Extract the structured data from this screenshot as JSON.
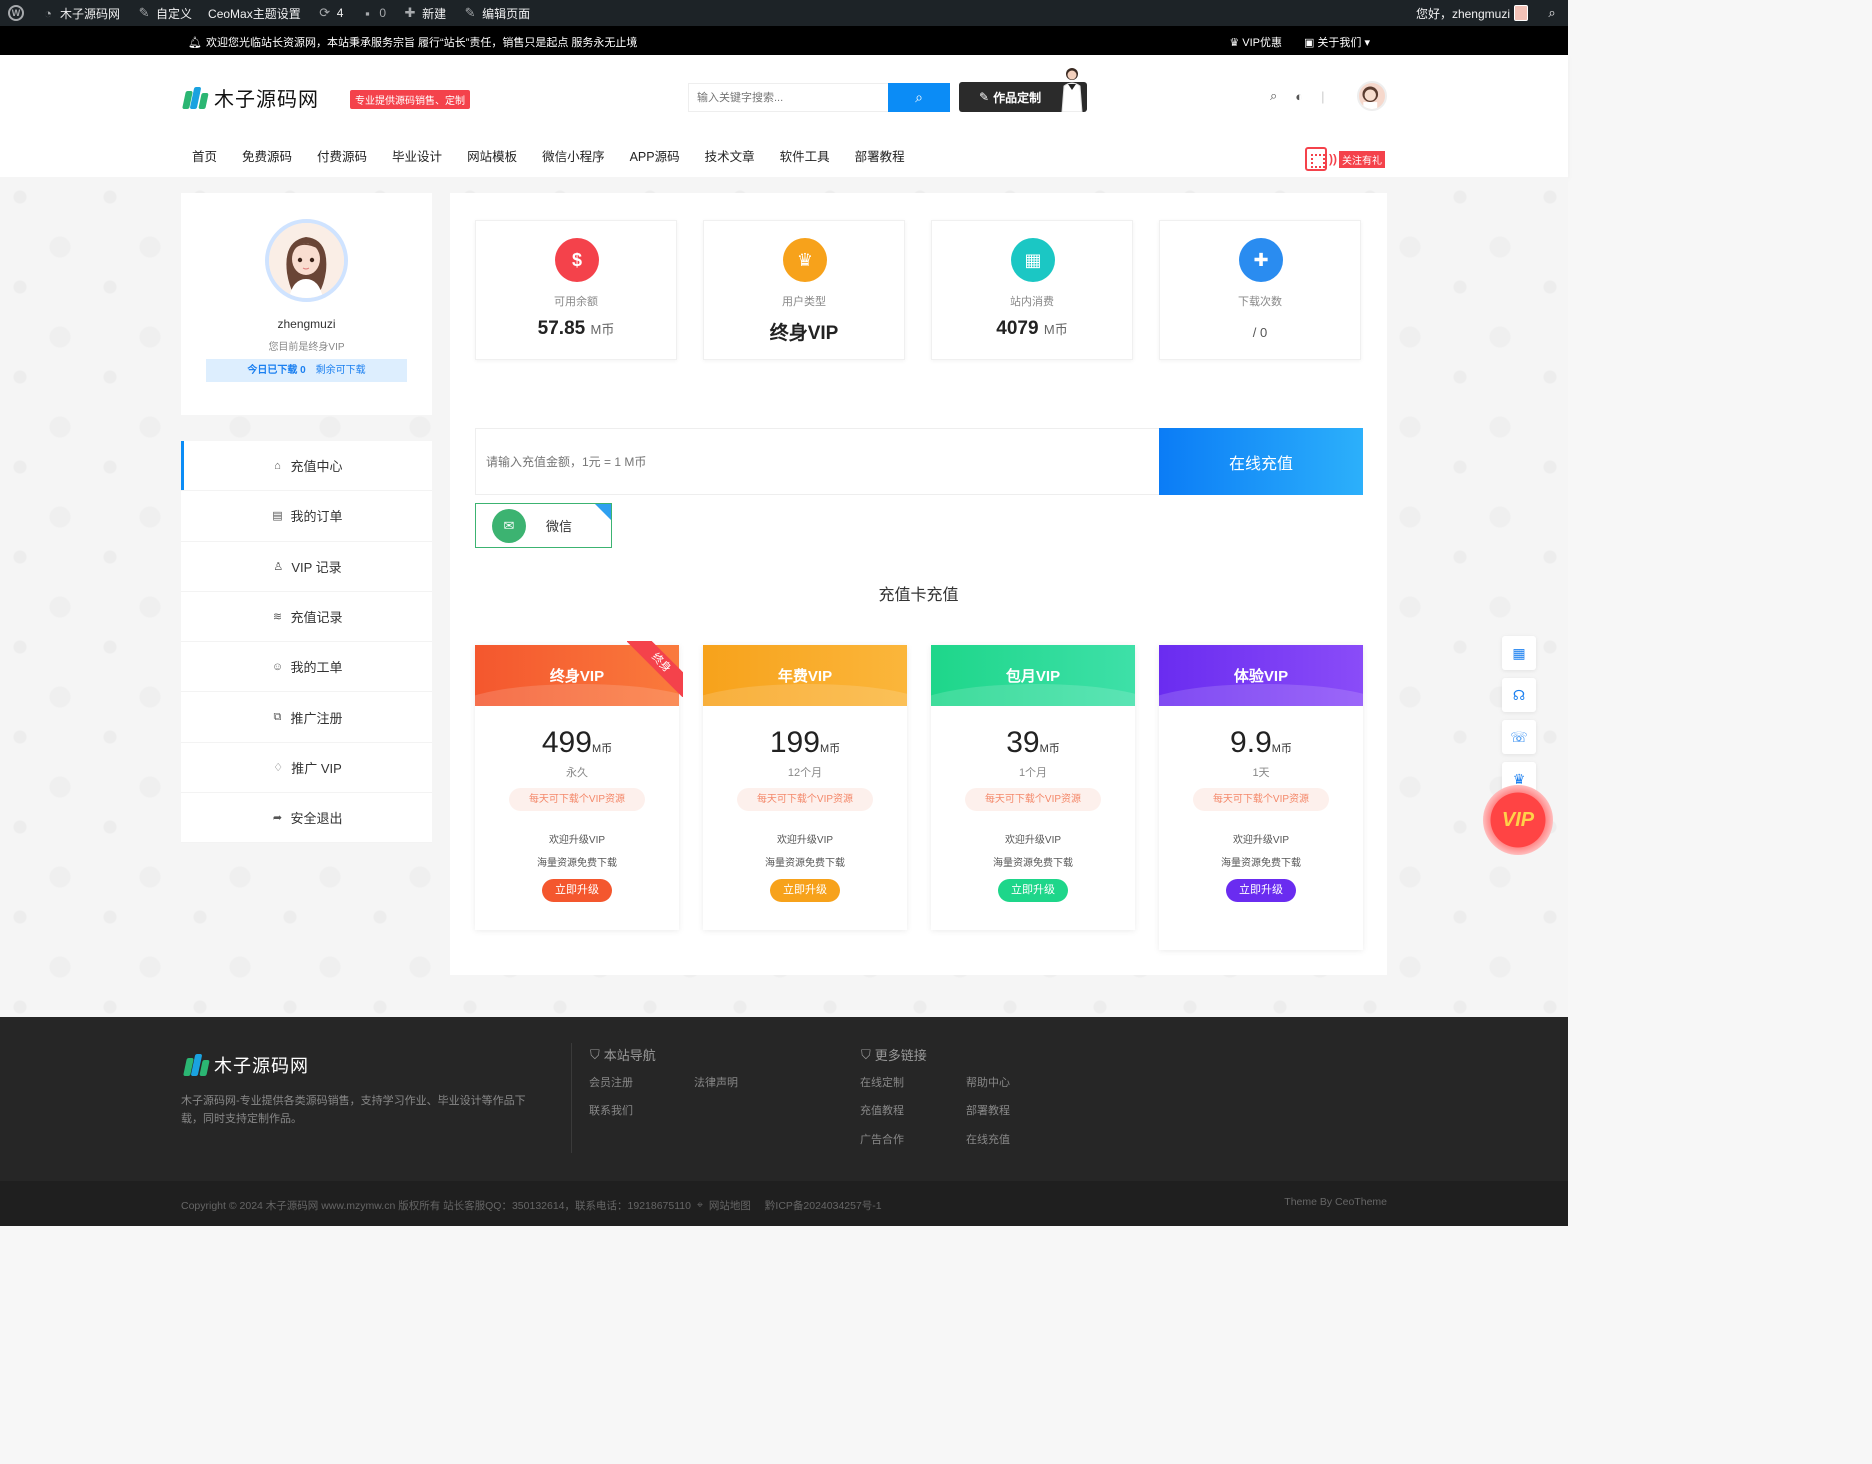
{
  "adminbar": {
    "site_name": "木子源码网",
    "customize": "自定义",
    "theme_settings": "CeoMax主题设置",
    "updates_count": "4",
    "comments_count": "0",
    "new": "新建",
    "edit_page": "编辑页面",
    "greeting": "您好，zhengmuzi"
  },
  "notice": {
    "text": "欢迎您光临站长资源网，本站秉承服务宗旨 履行“站长”责任，销售只是起点 服务永无止境",
    "vip_offer": "VIP优惠",
    "about": "关于我们"
  },
  "header": {
    "logo_text": "木子源码网",
    "tagline": "专业提供源码销售、定制",
    "search_placeholder": "输入关键字搜索...",
    "custom_button": "作品定制",
    "follow_tag": "关注有礼",
    "nav": [
      "首页",
      "免费源码",
      "付费源码",
      "毕业设计",
      "网站模板",
      "微信小程序",
      "APP源码",
      "技术文章",
      "软件工具",
      "部署教程"
    ]
  },
  "profile": {
    "username": "zhengmuzi",
    "status": "您目前是终身VIP",
    "downloaded_today": "今日已下载 0",
    "remaining": "剩余可下载"
  },
  "menu": [
    {
      "icon": "basket-icon",
      "glyph": "⌂",
      "label": "充值中心"
    },
    {
      "icon": "order-icon",
      "glyph": "▤",
      "label": "我的订单"
    },
    {
      "icon": "user-icon",
      "glyph": "♙",
      "label": "VIP 记录"
    },
    {
      "icon": "layers-icon",
      "glyph": "≋",
      "label": "充值记录"
    },
    {
      "icon": "smile-icon",
      "glyph": "☺",
      "label": "我的工单"
    },
    {
      "icon": "share-box-icon",
      "glyph": "⧉",
      "label": "推广注册"
    },
    {
      "icon": "diamond-icon",
      "glyph": "♢",
      "label": "推广 VIP"
    },
    {
      "icon": "logout-icon",
      "glyph": "➦",
      "label": "安全退出"
    }
  ],
  "stats": [
    {
      "icon": "money-bag-icon",
      "glyph": "$",
      "color": "#f4424b",
      "label": "可用余额",
      "value": "57.85",
      "unit": "M币"
    },
    {
      "icon": "crown-icon",
      "glyph": "♛",
      "color": "#f7a21b",
      "label": "用户类型",
      "value": "终身VIP",
      "unit": ""
    },
    {
      "icon": "cart-icon",
      "glyph": "▦",
      "color": "#1bc7c4",
      "label": "站内消费",
      "value": "4079",
      "unit": "M币"
    },
    {
      "icon": "gift-icon",
      "glyph": "✚",
      "color": "#2a8cf0",
      "label": "下载次数",
      "value": "/ 0",
      "unit": ""
    }
  ],
  "recharge": {
    "placeholder": "请输入充值金额，1元 = 1 M币",
    "button": "在线充值",
    "pay_method": "微信",
    "card_title": "充值卡充值"
  },
  "vip_cards": [
    {
      "title": "终身VIP",
      "price": "499",
      "unit": "M币",
      "duration": "永久",
      "perk": "每天可下载个VIP资源",
      "desc1": "欢迎升级VIP",
      "desc2": "海量资源免费下载",
      "button": "立即升级",
      "color_a": "#f4572e",
      "color_b": "#fa7a3c",
      "ribbon": "终身"
    },
    {
      "title": "年费VIP",
      "price": "199",
      "unit": "M币",
      "duration": "12个月",
      "perk": "每天可下载个VIP资源",
      "desc1": "欢迎升级VIP",
      "desc2": "海量资源免费下载",
      "button": "立即升级",
      "color_a": "#f7a21b",
      "color_b": "#fbb63b",
      "ribbon": ""
    },
    {
      "title": "包月VIP",
      "price": "39",
      "unit": "M币",
      "duration": "1个月",
      "perk": "每天可下载个VIP资源",
      "desc1": "欢迎升级VIP",
      "desc2": "海量资源免费下载",
      "button": "立即升级",
      "color_a": "#1ed68a",
      "color_b": "#3ee0a8",
      "ribbon": ""
    },
    {
      "title": "体验VIP",
      "price": "9.9",
      "unit": "M币",
      "duration": "1天",
      "perk": "每天可下载个VIP资源",
      "desc1": "欢迎升级VIP",
      "desc2": "海量资源免费下载",
      "button": "立即升级",
      "color_a": "#6a2cf0",
      "color_b": "#8a4cf8",
      "ribbon": ""
    }
  ],
  "float_vip": "VIP",
  "footer": {
    "logo_text": "木子源码网",
    "desc": "木子源码网-专业提供各类源码销售，支持学习作业、毕业设计等作品下载，同时支持定制作品。",
    "col1_title": "本站导航",
    "col1_links": [
      "会员注册",
      "法律声明",
      "联系我们"
    ],
    "col2_title": "更多链接",
    "col2_links": [
      "在线定制",
      "帮助中心",
      "充值教程",
      "部署教程",
      "广告合作",
      "在线充值"
    ],
    "copyright": "Copyright © 2024 木子源码网 www.mzymw.cn 版权所有 站长客服QQ：350132614，联系电话：19218675110",
    "sitemap": "网站地图",
    "icp": "黔ICP备2024034257号-1",
    "theme_by": "Theme By CeoTheme"
  }
}
